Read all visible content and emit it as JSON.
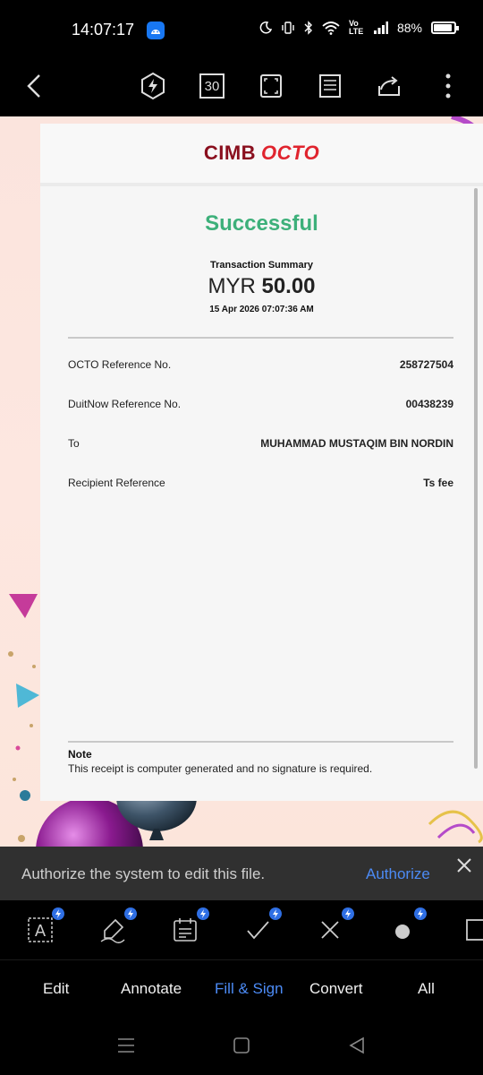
{
  "status_bar": {
    "time": "14:07:17",
    "battery": "88%",
    "network": "Vo LTE"
  },
  "toolbar": {
    "page_count": "30"
  },
  "receipt": {
    "brand_left": "CIMB",
    "brand_right": "OCTO",
    "status": "Successful",
    "summary_label": "Transaction Summary",
    "currency": "MYR",
    "amount": "50.00",
    "datetime": "15 Apr 2026 07:07:36 AM",
    "rows": [
      {
        "label": "OCTO Reference No.",
        "value": "258727504"
      },
      {
        "label": "DuitNow Reference No.",
        "value": "00438239"
      },
      {
        "label": "To",
        "value": "MUHAMMAD MUSTAQIM BIN NORDIN"
      },
      {
        "label": "Recipient Reference",
        "value": "Ts fee"
      }
    ],
    "note_title": "Note",
    "note_text": "This receipt is computer generated and no signature is required."
  },
  "auth_bar": {
    "message": "Authorize the system to edit this file.",
    "button": "Authorize"
  },
  "tools": [
    "text-box-icon",
    "pen-sign-icon",
    "form-field-icon",
    "check-mark-icon",
    "cross-mark-icon",
    "dot-icon",
    "rectangle-icon"
  ],
  "tabs": [
    {
      "label": "Edit",
      "active": false
    },
    {
      "label": "Annotate",
      "active": false
    },
    {
      "label": "Fill & Sign",
      "active": true
    },
    {
      "label": "Convert",
      "active": false
    },
    {
      "label": "All",
      "active": false
    }
  ],
  "colors": {
    "success": "#3db07a",
    "accent": "#4c8bf5",
    "brand_dark": "#8a0f1e",
    "brand_red": "#e0242e"
  }
}
